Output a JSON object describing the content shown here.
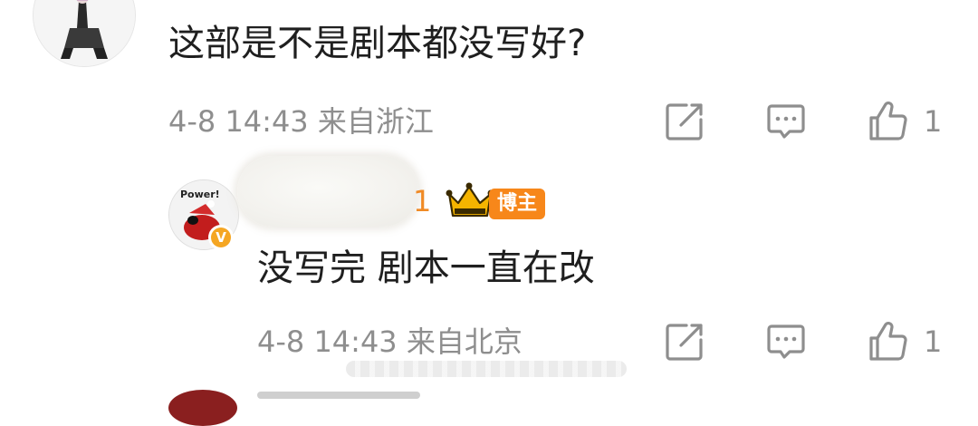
{
  "comment": {
    "text": "这部是不是剧本都没写好?",
    "date": "4-8 14:43",
    "location": "来自浙江",
    "like_count": "1",
    "actions": [
      "share-icon",
      "comment-icon",
      "like-icon"
    ]
  },
  "reply": {
    "avatar_text": "Power!",
    "verified_mark": "V",
    "name_visible_tail": "1",
    "role_badge": "博主",
    "text": "没写完 剧本一直在改",
    "date": "4-8 14:43",
    "location": "来自北京",
    "like_count": "1",
    "actions": [
      "share-icon",
      "comment-icon",
      "like-icon"
    ]
  },
  "colors": {
    "text_primary": "#1f1f1f",
    "text_meta": "#8e8e8e",
    "accent_orange": "#f7871a",
    "crown_gold": "#f5b400"
  }
}
